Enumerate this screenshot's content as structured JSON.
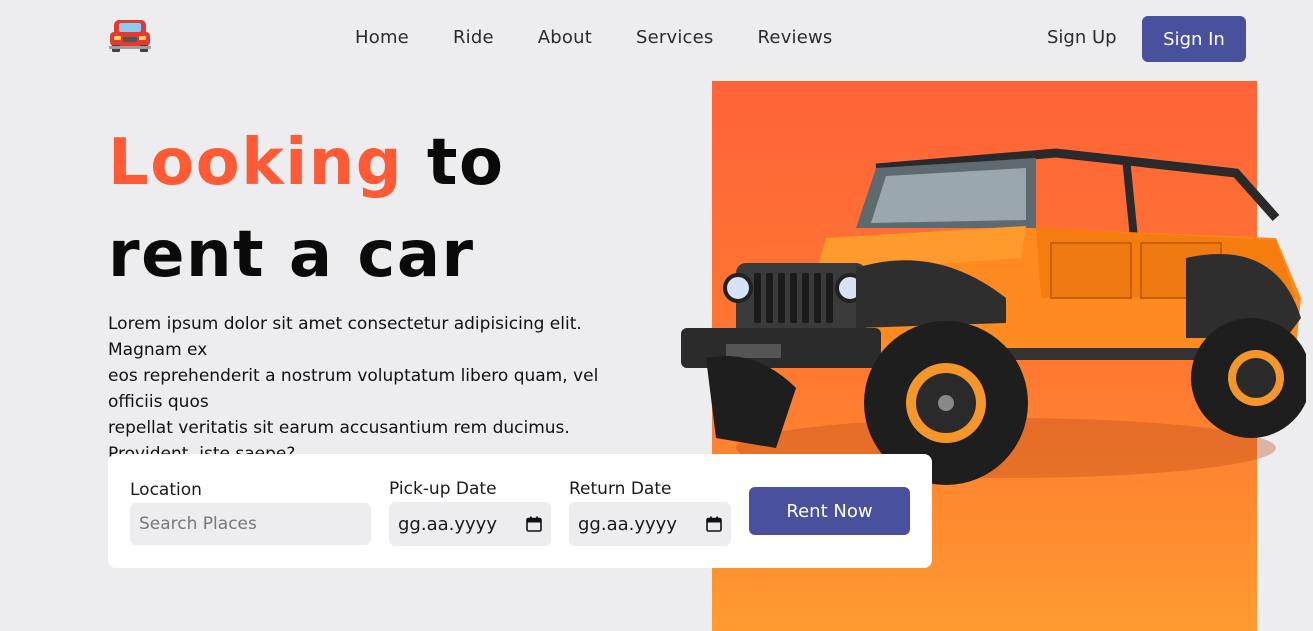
{
  "nav": {
    "items": [
      "Home",
      "Ride",
      "About",
      "Services",
      "Reviews"
    ]
  },
  "auth": {
    "signup": "Sign Up",
    "signin": "Sign In"
  },
  "hero": {
    "title_accent": "Looking",
    "title_rest": "to",
    "title_line2": "rent a car",
    "desc_lines": [
      "Lorem ipsum dolor sit amet consectetur adipisicing elit.",
      "Magnam ex",
      "eos reprehenderit a nostrum voluptatum libero quam, vel",
      "officiis quos",
      "repellat veritatis sit earum accusantium rem ducimus.",
      "Provident, iste saepe?"
    ]
  },
  "form": {
    "location_label": "Location",
    "location_placeholder": "Search Places",
    "pickup_label": "Pick-up Date",
    "pickup_value": "gg.aa.yyyy",
    "return_label": "Return Date",
    "return_value": "gg.aa.yyyy",
    "rent_button": "Rent Now"
  },
  "icons": [
    "red-car-logo-icon",
    "calendar-icon",
    "calendar-icon"
  ],
  "colors": {
    "accent": "#ff5a36",
    "primary": "#49509e",
    "hero_bg": "#ff6338"
  }
}
